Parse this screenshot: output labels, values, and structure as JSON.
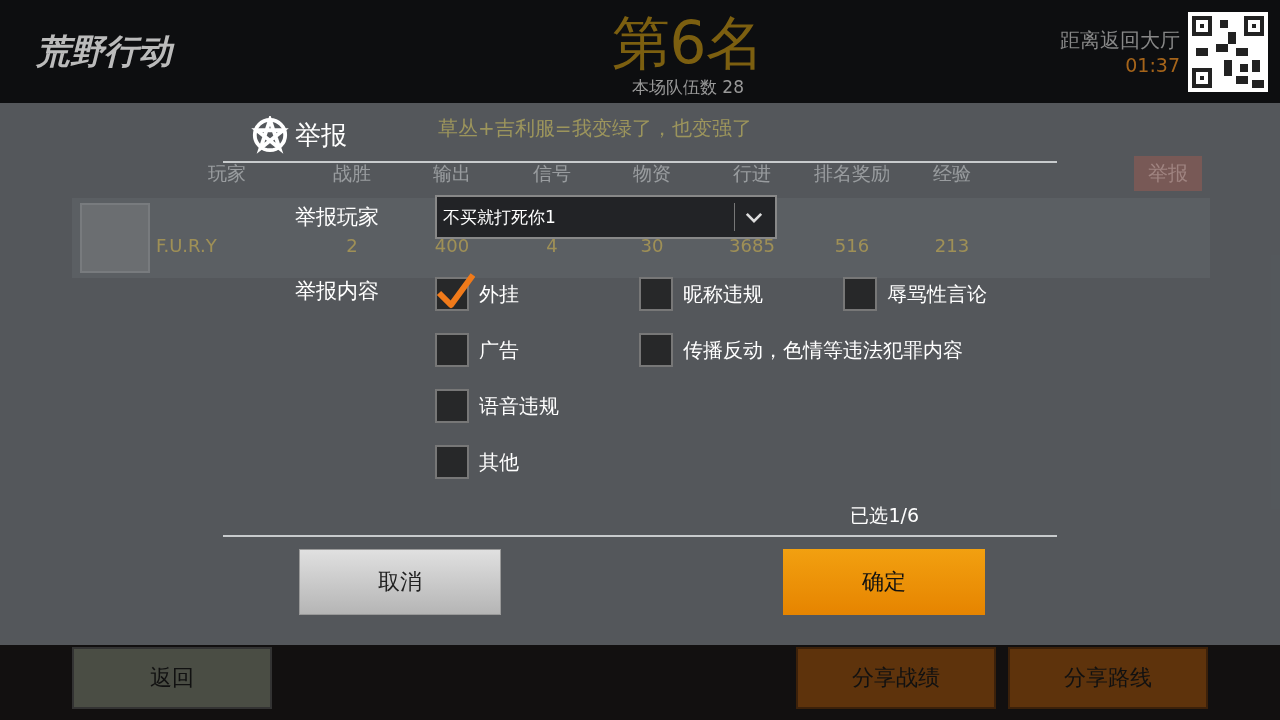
{
  "header": {
    "logo": "荒野行动",
    "rank": "第6名",
    "team_count": "本场队伍数 28",
    "countdown_label": "距离返回大厅",
    "countdown": "01:37"
  },
  "background": {
    "slogan": "草丛+吉利服=我变绿了，也变强了",
    "columns": [
      "玩家",
      "战胜",
      "输出",
      "信号",
      "物资",
      "行进",
      "排名奖励",
      "经验"
    ],
    "report_button": "举报",
    "rows": [
      {
        "cells": [
          "F.U.R.Y",
          "2",
          "400",
          "4",
          "30",
          "3685",
          "516",
          "213"
        ]
      }
    ]
  },
  "dialog": {
    "title": "举报",
    "player_label": "举报玩家",
    "player_value": "不买就打死你1",
    "content_label": "举报内容",
    "options": [
      {
        "label": "外挂",
        "checked": true
      },
      {
        "label": "昵称违规",
        "checked": false
      },
      {
        "label": "辱骂性言论",
        "checked": false
      },
      {
        "label": "广告",
        "checked": false
      },
      {
        "label": "传播反动，色情等违法犯罪内容",
        "checked": false
      },
      {
        "label": "语音违规",
        "checked": false
      },
      {
        "label": "其他",
        "checked": false
      }
    ],
    "selected_count": "已选1/6",
    "cancel": "取消",
    "confirm": "确定"
  },
  "footer": {
    "back": "返回",
    "share_stats": "分享战绩",
    "share_route": "分享路线"
  }
}
